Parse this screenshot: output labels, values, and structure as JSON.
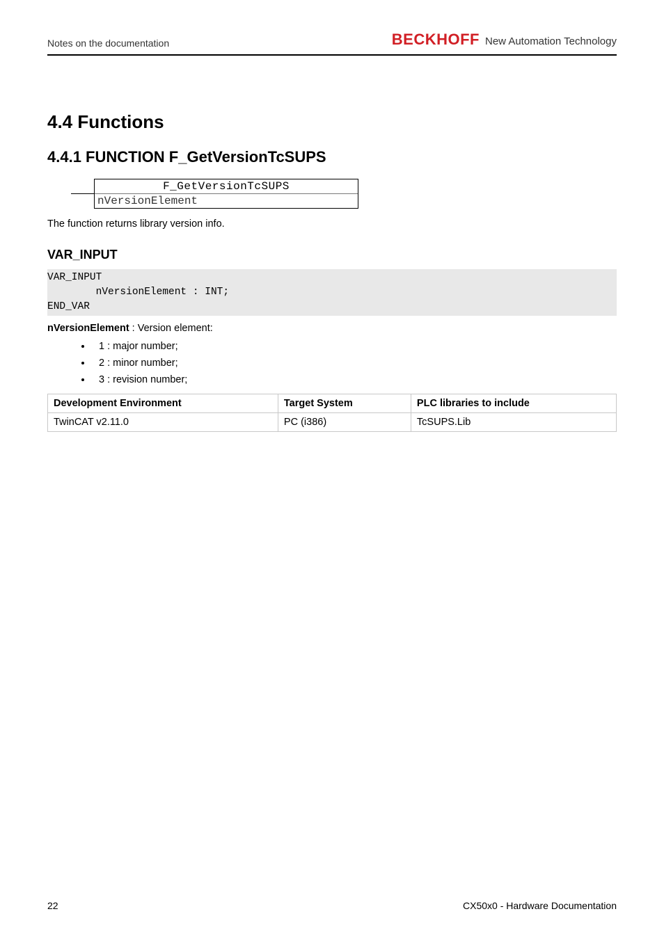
{
  "header": {
    "running_left": "Notes on the documentation",
    "brand_name": "BECKHOFF",
    "brand_tagline": "New Automation Technology"
  },
  "section": {
    "h2": "4.4 Functions",
    "h3": "4.4.1 FUNCTION F_GetVersionTcSUPS",
    "fn_diagram": {
      "title": "F_GetVersionTcSUPS",
      "port": "nVersionElement"
    },
    "desc": "The function returns library version info.",
    "h4": "VAR_INPUT",
    "code": "VAR_INPUT\n        nVersionElement : INT;\nEND_VAR",
    "nversion_label": "nVersionElement",
    "nversion_desc": " : Version element:",
    "bullets": [
      "1 : major number;",
      "2 : minor number;",
      "3 : revision number;"
    ],
    "table": {
      "headers": [
        "Development Environment",
        "Target System",
        "PLC libraries to include"
      ],
      "rows": [
        [
          "TwinCAT v2.11.0",
          "PC (i386)",
          "TcSUPS.Lib"
        ]
      ]
    }
  },
  "footer": {
    "page": "22",
    "doc": "CX50x0 - Hardware Documentation"
  }
}
